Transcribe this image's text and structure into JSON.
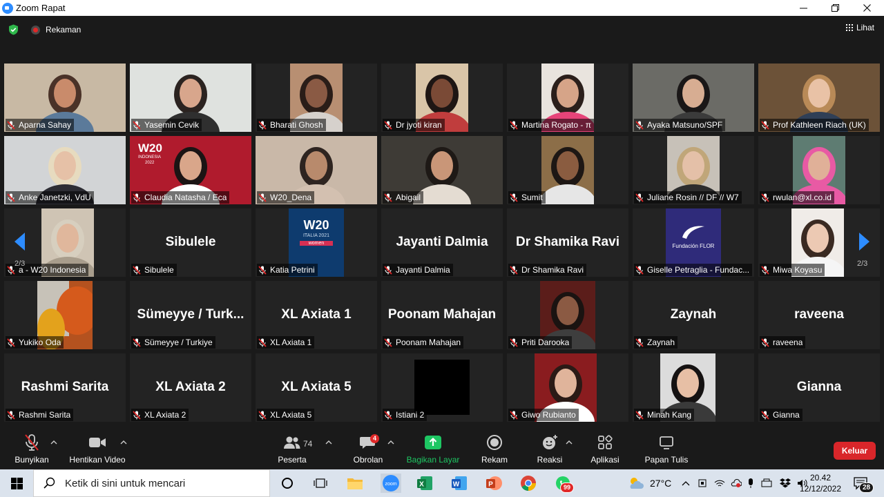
{
  "window": {
    "title": "Zoom Rapat",
    "controls": [
      "minimize",
      "restore",
      "close"
    ]
  },
  "topbar": {
    "recording_label": "Rekaman",
    "view_label": "Lihat"
  },
  "gallery": {
    "page_indicator": "2/3",
    "participants": [
      {
        "label": "Aparna Sahay",
        "big": "",
        "video": true
      },
      {
        "label": "Yasemin Cevik",
        "big": "",
        "video": true
      },
      {
        "label": "Bharati Ghosh",
        "big": "",
        "video": true
      },
      {
        "label": "Dr jyoti kiran",
        "big": "",
        "video": true
      },
      {
        "label": "Martina Rogato - π",
        "big": "",
        "video": true
      },
      {
        "label": "Ayaka Matsuno/SPF",
        "big": "",
        "video": true
      },
      {
        "label": "Prof Kathleen Riach (UK)",
        "big": "",
        "video": true
      },
      {
        "label": "Anke Janetzki, VdU",
        "big": "",
        "video": true
      },
      {
        "label": "Claudia Natasha / Eca",
        "big": "",
        "video": true,
        "overlay": [
          "W20",
          "INDONESIA",
          "2022"
        ]
      },
      {
        "label": "W20_Dena",
        "big": "",
        "video": true
      },
      {
        "label": "Abigail",
        "big": "",
        "video": true
      },
      {
        "label": "Sumit",
        "big": "",
        "video": true
      },
      {
        "label": "Juliane Rosin // DF // W7",
        "big": "",
        "video": true
      },
      {
        "label": "rwulan@xl.co.id",
        "big": "",
        "video": true
      },
      {
        "label": "a - W20 Indonesia",
        "big": "",
        "video": true
      },
      {
        "label": "Sibulele",
        "big": "Sibulele",
        "video": false
      },
      {
        "label": "Katia Petrini",
        "big": "",
        "video": true,
        "overlay": [
          "W20",
          "ITALIA 2021",
          "women"
        ]
      },
      {
        "label": "Jayanti Dalmia",
        "big": "Jayanti Dalmia",
        "video": false
      },
      {
        "label": "Dr Shamika Ravi",
        "big": "Dr Shamika Ravi",
        "video": false
      },
      {
        "label": "Giselle Petraglia - Fundac...",
        "big": "",
        "video": true,
        "overlay": [
          "Fundación FLOR"
        ]
      },
      {
        "label": "Miwa Koyasu",
        "big": "",
        "video": true
      },
      {
        "label": "Yukiko Oda",
        "big": "",
        "video": true
      },
      {
        "label": "Sümeyye / Turkiye",
        "big": "Sümeyye / Turk...",
        "video": false
      },
      {
        "label": "XL Axiata 1",
        "big": "XL Axiata 1",
        "video": false
      },
      {
        "label": "Poonam Mahajan",
        "big": "Poonam Mahajan",
        "video": false
      },
      {
        "label": "Priti Darooka",
        "big": "",
        "video": true
      },
      {
        "label": "Zaynah",
        "big": "Zaynah",
        "video": false
      },
      {
        "label": "raveena",
        "big": "raveena",
        "video": false
      },
      {
        "label": "Rashmi Sarita",
        "big": "Rashmi Sarita",
        "video": false
      },
      {
        "label": "XL Axiata 2",
        "big": "XL Axiata 2",
        "video": false
      },
      {
        "label": "XL Axiata 5",
        "big": "XL Axiata 5",
        "video": false
      },
      {
        "label": "Istiani 2",
        "big": "",
        "video": true
      },
      {
        "label": "Giwo Rubianto",
        "big": "",
        "video": true
      },
      {
        "label": "Minah Kang",
        "big": "",
        "video": true
      },
      {
        "label": "Gianna",
        "big": "Gianna",
        "video": false
      }
    ]
  },
  "toolbar": {
    "mute": "Bunyikan",
    "stop_video": "Hentikan Video",
    "participants": "Peserta",
    "participants_count": "74",
    "chat": "Obrolan",
    "chat_badge": "4",
    "share": "Bagikan Layar",
    "record": "Rekam",
    "reactions": "Reaksi",
    "apps": "Aplikasi",
    "whiteboard": "Papan Tulis",
    "leave": "Keluar"
  },
  "taskbar": {
    "search_placeholder": "Ketik di sini untuk mencari",
    "weather": "27°C",
    "time": "20.42",
    "date": "12/12/2022",
    "notification_count": "28",
    "whatsapp_badge": "99",
    "colors": {
      "share_green": "#1ec763",
      "leave_red": "#d9262a",
      "zoom_blue": "#2d8cff"
    }
  }
}
